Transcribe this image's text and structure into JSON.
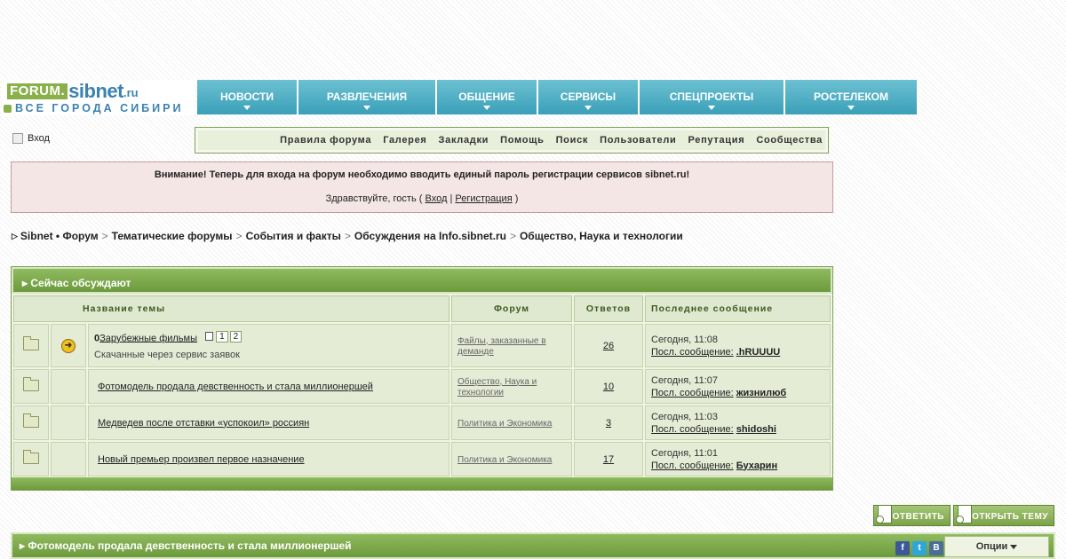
{
  "logo": {
    "forum": "FORUM.",
    "sibnet": "sibnet",
    "ru": ".ru",
    "tagline": "ВСЕ ГОРОДА СИБИРИ"
  },
  "nav": [
    "НОВОСТИ",
    "РАЗВЛЕЧЕНИЯ",
    "ОБЩЕНИЕ",
    "СЕРВИСЫ",
    "СПЕЦПРОЕКТЫ",
    "РОСТЕЛЕКОМ"
  ],
  "login": {
    "label": "Вход"
  },
  "forum_menu": [
    "Правила форума",
    "Галерея",
    "Закладки",
    "Помощь",
    "Поиск",
    "Пользователи",
    "Репутация",
    "Сообщества"
  ],
  "notice": {
    "warning": "Внимание! Теперь для входа на форум необходимо вводить единый пароль регистрации сервисов sibnet.ru!",
    "greeting": "Здравствуйте, гость (",
    "login_link": "Вход",
    "divider": "|",
    "register_link": "Регистрация",
    "closing": ")"
  },
  "breadcrumb": [
    "Sibnet • Форум",
    "Тематические форумы",
    "События и факты",
    "Обсуждения на Info.sibnet.ru",
    "Общество, Наука и технологии"
  ],
  "active": {
    "title": "Сейчас обсуждают",
    "columns": {
      "name": "Название темы",
      "forum": "Форум",
      "replies": "Ответов",
      "last": "Последнее сообщение"
    },
    "last_label": "Посл. сообщение:",
    "rows": [
      {
        "prefix": "0",
        "title": "Зарубежные фильмы",
        "pages": [
          "1",
          "2"
        ],
        "desc": "Скачанные через сервис заявок",
        "forum": "Файлы, заказанные в деманде",
        "replies": "26",
        "time": "Сегодня, 11:08",
        "user": ".hRUUUU"
      },
      {
        "title": "Фотомодель продала девственность и стала миллионершей",
        "forum": "Общество, Наука и технологии",
        "replies": "10",
        "time": "Сегодня, 11:07",
        "user": "жизнилюб"
      },
      {
        "title": "Медведев после отставки «успокоил» россиян",
        "forum": "Политика и Экономика",
        "replies": "3",
        "time": "Сегодня, 11:03",
        "user": "shidoshi"
      },
      {
        "title": "Новый премьер произвел первое назначение",
        "forum": "Политика и Экономика",
        "replies": "17",
        "time": "Сегодня, 11:01",
        "user": "Бухарин"
      }
    ]
  },
  "buttons": {
    "reply": "ОТВЕТИТЬ",
    "new_topic": "ОТКРЫТЬ ТЕМУ"
  },
  "topic_bar": {
    "title": "Фотомодель продала девственность и стала миллионершей",
    "options": "Опции"
  },
  "social": {
    "fb": "f",
    "tw": "t",
    "vk": "B"
  },
  "colors": {
    "nav": "#3aa0b8",
    "green": "#7ba24a",
    "notice_bg": "#f5e6e6"
  }
}
